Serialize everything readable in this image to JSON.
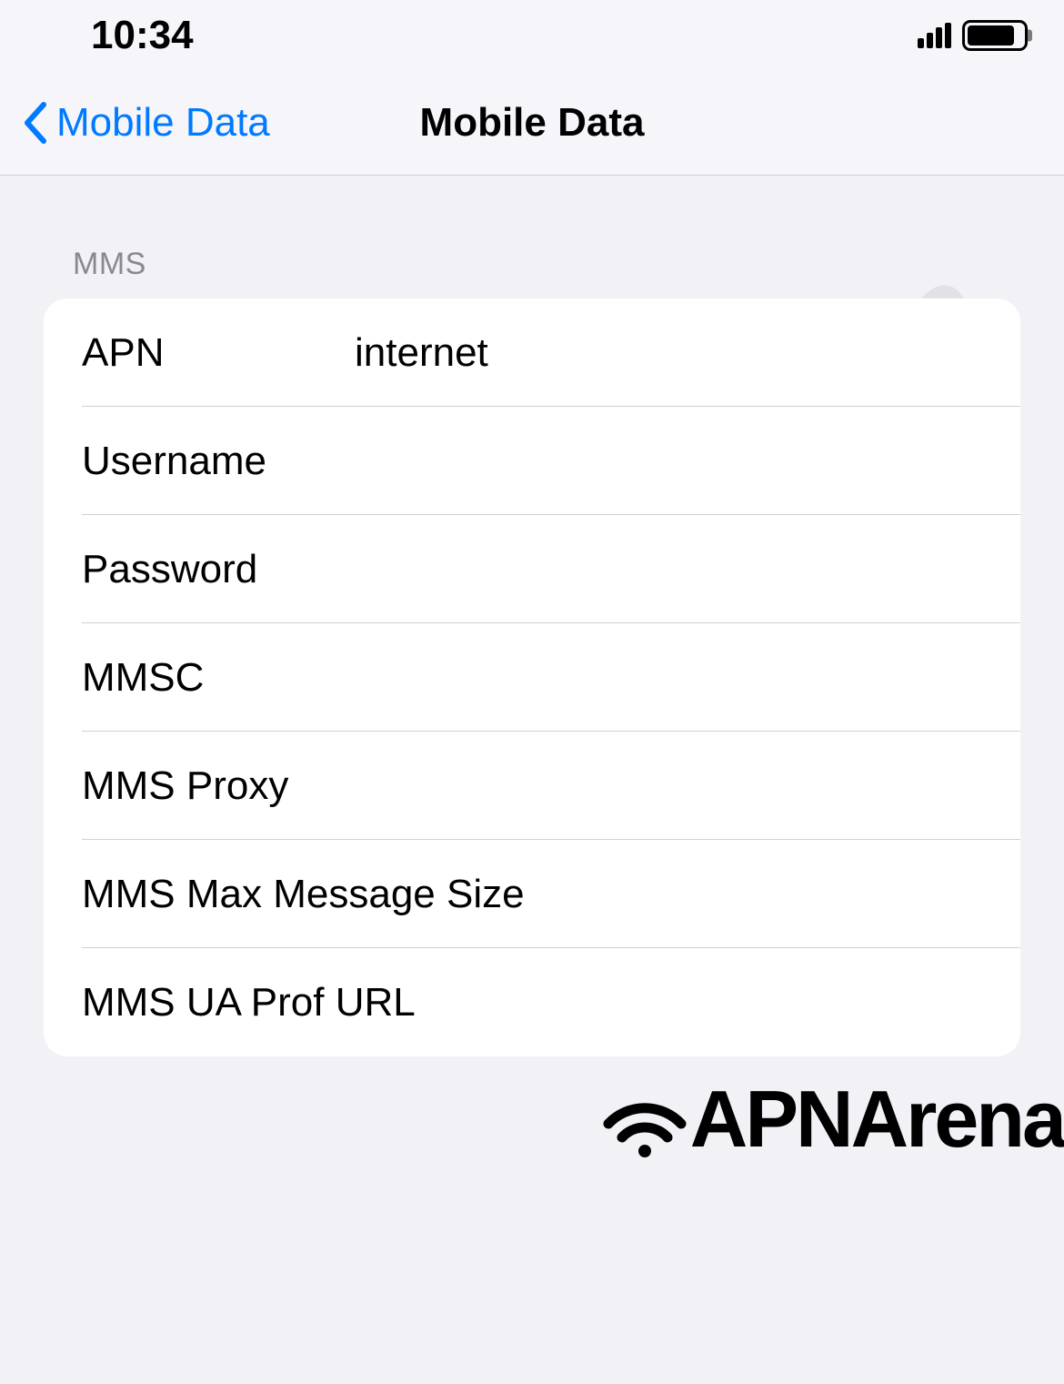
{
  "statusBar": {
    "time": "10:34"
  },
  "nav": {
    "back": "Mobile Data",
    "title": "Mobile Data"
  },
  "section": {
    "header": "MMS",
    "rows": [
      {
        "label": "APN",
        "value": "internet"
      },
      {
        "label": "Username",
        "value": ""
      },
      {
        "label": "Password",
        "value": ""
      },
      {
        "label": "MMSC",
        "value": ""
      },
      {
        "label": "MMS Proxy",
        "value": ""
      },
      {
        "label": "MMS Max Message Size",
        "value": ""
      },
      {
        "label": "MMS UA Prof URL",
        "value": ""
      }
    ]
  },
  "branding": {
    "name": "APNArena"
  }
}
